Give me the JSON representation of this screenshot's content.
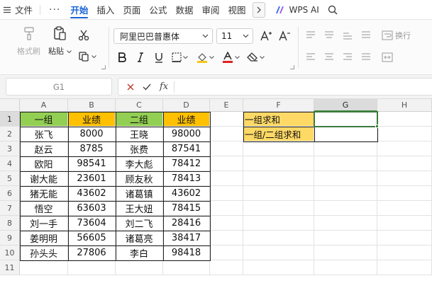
{
  "menubar": {
    "hamburger_icon": "menu-icon",
    "file_label": "文件",
    "more_label": "···",
    "tabs": [
      "开始",
      "插入",
      "页面",
      "公式",
      "数据",
      "审阅",
      "视图"
    ],
    "active_tab": "开始",
    "ai_label": "WPS AI"
  },
  "ribbon": {
    "format_painter_label": "格式刷",
    "paste_label": "粘贴",
    "font_name": "阿里巴巴普惠体",
    "font_size": "11",
    "wrap_label": "换行",
    "font_color": "#e02020",
    "fill_color": "#f5c518"
  },
  "formula_bar": {
    "cell_ref": "G1",
    "fx_label": "fx",
    "formula": ""
  },
  "sheet": {
    "columns": [
      "A",
      "B",
      "C",
      "D",
      "E",
      "F",
      "G",
      "H"
    ],
    "rows": [
      "1",
      "2",
      "3",
      "4",
      "5",
      "6",
      "7",
      "8",
      "9",
      "10",
      "11"
    ],
    "selected_column": "G",
    "selected_row": "1",
    "header": [
      "一组",
      "业绩",
      "二组",
      "业绩"
    ],
    "data": [
      [
        "张飞",
        "8000",
        "王晓",
        "98000"
      ],
      [
        "赵云",
        "8785",
        "张费",
        "87541"
      ],
      [
        "欧阳",
        "98541",
        "李大彪",
        "78412"
      ],
      [
        "谢大能",
        "23601",
        "顾友秋",
        "78413"
      ],
      [
        "猪无能",
        "43602",
        "诸葛镇",
        "43602"
      ],
      [
        "悟空",
        "63603",
        "王大妞",
        "78415"
      ],
      [
        "刘一手",
        "73604",
        "刘二飞",
        "28416"
      ],
      [
        "姜明明",
        "56605",
        "诸葛亮",
        "38417"
      ],
      [
        "孙头头",
        "27806",
        "李白",
        "98418"
      ]
    ],
    "labels": [
      "一组求和",
      "一组/二组求和"
    ],
    "header_green": "#92cf52",
    "header_orange": "#ffc000",
    "label_yellow": "#ffd966"
  }
}
